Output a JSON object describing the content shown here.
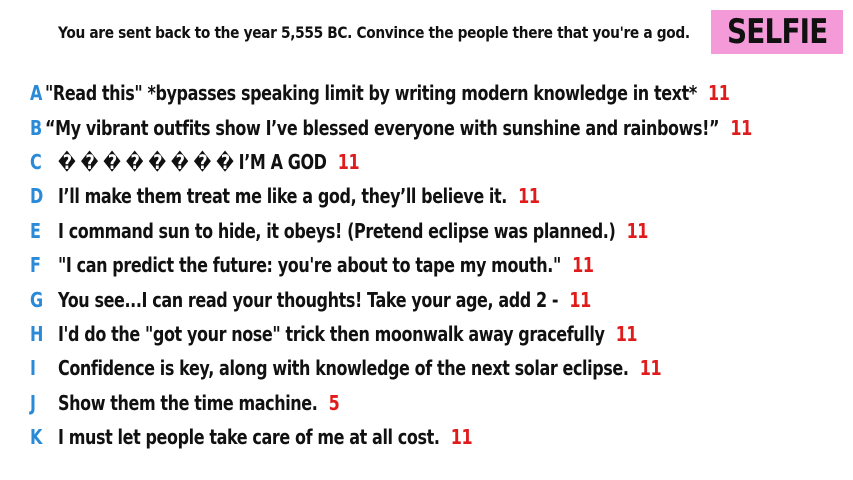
{
  "colors": {
    "letter": "#2a8ad8",
    "score": "#e01b1b",
    "badge_bg": "#f59ad8",
    "text": "#111111"
  },
  "prompt": "You are sent back to the year 5,555 BC. Convince the people there that you're a god.",
  "badge": "SELFIE",
  "answers": [
    {
      "letter": "A",
      "text": "\"Read this\" *bypasses speaking limit by writing modern knowledge in text*",
      "score": "11"
    },
    {
      "letter": "B",
      "text": "“My vibrant outfits show I’ve blessed everyone with sunshine and rainbows!”",
      "score": "11"
    },
    {
      "letter": "C",
      "text": "� � � � � � � � I’M A GOD",
      "score": "11"
    },
    {
      "letter": "D",
      "text": "I’ll make them treat me like a god, they’ll believe it.",
      "score": "11"
    },
    {
      "letter": "E",
      "text": "I command sun to hide, it obeys! (Pretend eclipse was planned.)",
      "score": "11"
    },
    {
      "letter": "F",
      "text": "\"I can predict the future: you're about to tape my mouth.\"",
      "score": "11"
    },
    {
      "letter": "G",
      "text": "You see...I can read your thoughts! Take your age, add 2 -",
      "score": "11"
    },
    {
      "letter": "H",
      "text": "I'd do the \"got your nose\" trick then moonwalk away gracefully",
      "score": "11"
    },
    {
      "letter": "I",
      "text": "Confidence is key, along with knowledge of the next solar eclipse.",
      "score": "11"
    },
    {
      "letter": "J",
      "text": "Show them the time machine.",
      "score": "5"
    },
    {
      "letter": "K",
      "text": "I must let people take care of me at all cost.",
      "score": "11"
    }
  ]
}
